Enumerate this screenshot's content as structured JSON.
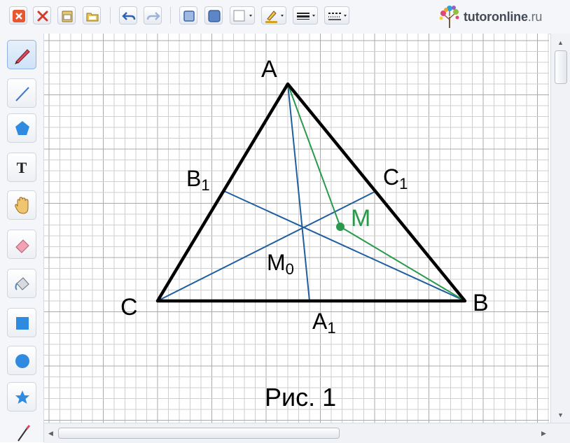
{
  "toolbar": {
    "buttons": [
      "close-icon",
      "delete-icon",
      "clipboard-icon",
      "folder-icon",
      "undo-icon",
      "redo-icon",
      "frame-square-icon",
      "filled-square-icon",
      "color-picker-icon",
      "pen-color-icon",
      "line-width-icon",
      "line-style-icon"
    ]
  },
  "logo": {
    "brand": "tutoronline",
    "domain": ".ru"
  },
  "sidebar": {
    "tools": [
      "pencil-icon",
      "line-icon",
      "pentagon-icon",
      "text-icon",
      "hand-icon",
      "eraser-icon",
      "fill-bucket-icon",
      "square-icon",
      "circle-icon",
      "star-icon"
    ],
    "text_tool_glyph": "T"
  },
  "figure": {
    "vertices": {
      "A": "A",
      "B": "B",
      "C": "C"
    },
    "midpoints": {
      "A1": {
        "base": "A",
        "sub": "1"
      },
      "B1": {
        "base": "B",
        "sub": "1"
      },
      "C1": {
        "base": "C",
        "sub": "1"
      }
    },
    "centroid": {
      "base": "M",
      "sub": "0"
    },
    "point": "M",
    "caption": "Рис. 1"
  },
  "colors": {
    "triangle": "#000000",
    "medians": "#1f5fa0",
    "green": "#2a9a4a",
    "grid": "#c8c8c8"
  }
}
